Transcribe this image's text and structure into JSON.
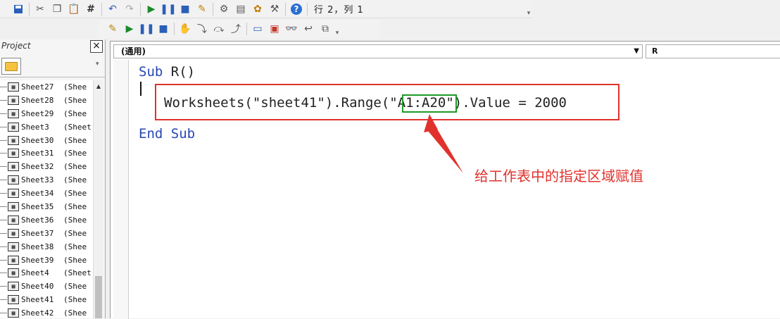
{
  "toolbar": {
    "position_label": "行 2，列 1",
    "icons_row1": [
      "save-icon",
      "cut-icon",
      "copy-icon",
      "paste-icon",
      "find-icon",
      "undo-icon",
      "redo-icon",
      "run-icon",
      "break-icon",
      "reset-icon",
      "design-mode-icon",
      "project-explorer-icon",
      "properties-icon",
      "object-browser-icon",
      "toolbox-icon",
      "help-icon"
    ],
    "icons_row2": [
      "design-mode-icon",
      "run-icon",
      "break-icon",
      "reset-icon",
      "toggle-breakpoint-icon",
      "step-into-icon",
      "step-over-icon",
      "step-out-icon",
      "locals-icon",
      "immediate-icon",
      "watch-icon",
      "quick-watch-icon",
      "call-stack-icon"
    ]
  },
  "project": {
    "title": "Project",
    "close_label": "×",
    "items": [
      {
        "name": "Sheet27",
        "suffix": "(Shee"
      },
      {
        "name": "Sheet28",
        "suffix": "(Shee"
      },
      {
        "name": "Sheet29",
        "suffix": "(Shee"
      },
      {
        "name": "Sheet3",
        "suffix": "(Sheet"
      },
      {
        "name": "Sheet30",
        "suffix": "(Shee"
      },
      {
        "name": "Sheet31",
        "suffix": "(Shee"
      },
      {
        "name": "Sheet32",
        "suffix": "(Shee"
      },
      {
        "name": "Sheet33",
        "suffix": "(Shee"
      },
      {
        "name": "Sheet34",
        "suffix": "(Shee"
      },
      {
        "name": "Sheet35",
        "suffix": "(Shee"
      },
      {
        "name": "Sheet36",
        "suffix": "(Shee"
      },
      {
        "name": "Sheet37",
        "suffix": "(Shee"
      },
      {
        "name": "Sheet38",
        "suffix": "(Shee"
      },
      {
        "name": "Sheet39",
        "suffix": "(Shee"
      },
      {
        "name": "Sheet4",
        "suffix": "(Sheet"
      },
      {
        "name": "Sheet40",
        "suffix": "(Shee"
      },
      {
        "name": "Sheet41",
        "suffix": "(Shee"
      },
      {
        "name": "Sheet42",
        "suffix": "(Shee"
      }
    ]
  },
  "code_window": {
    "object_combo": "(通用)",
    "procedure_combo": "R",
    "line1_kw": "Sub",
    "line1_rest": " R()",
    "line2": "Worksheets(\"sheet41\").Range(\"A1:A20\").Value = 2000",
    "line3": "End Sub"
  },
  "annotation": {
    "text": "给工作表中的指定区域赋值",
    "colors": {
      "red": "#e0322d",
      "green": "#1f9a26"
    }
  }
}
